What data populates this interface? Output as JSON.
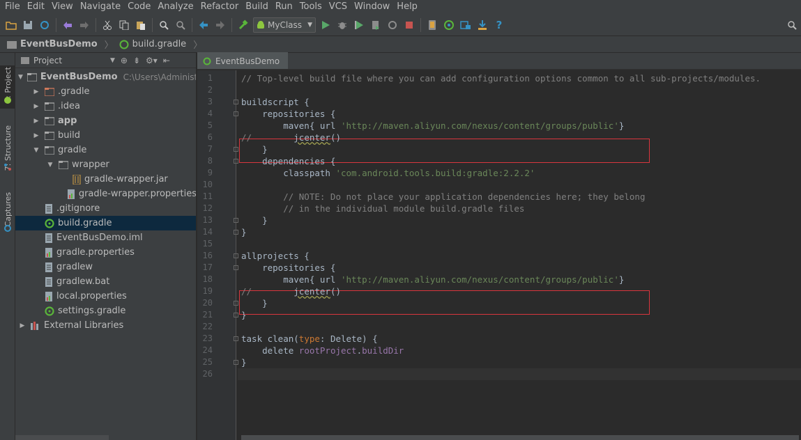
{
  "menu": [
    "File",
    "Edit",
    "View",
    "Navigate",
    "Code",
    "Analyze",
    "Refactor",
    "Build",
    "Run",
    "Tools",
    "VCS",
    "Window",
    "Help"
  ],
  "toolbar": {
    "run_config": "MyClass"
  },
  "breadcrumb": [
    "EventBusDemo",
    "build.gradle"
  ],
  "side_tabs": [
    "1: Project",
    "7: Structure",
    "Captures"
  ],
  "project": {
    "header": "Project",
    "tree": [
      {
        "label": "EventBusDemo",
        "path": "C:\\Users\\Administra",
        "indent": 0,
        "arrow": "down",
        "icon": "folder",
        "bold": true
      },
      {
        "label": ".gradle",
        "indent": 1,
        "arrow": "right",
        "icon": "folder-red"
      },
      {
        "label": ".idea",
        "indent": 1,
        "arrow": "right",
        "icon": "folder"
      },
      {
        "label": "app",
        "indent": 1,
        "arrow": "right",
        "icon": "folder",
        "bold": true
      },
      {
        "label": "build",
        "indent": 1,
        "arrow": "right",
        "icon": "folder"
      },
      {
        "label": "gradle",
        "indent": 1,
        "arrow": "down",
        "icon": "folder"
      },
      {
        "label": "wrapper",
        "indent": 2,
        "arrow": "down",
        "icon": "folder"
      },
      {
        "label": "gradle-wrapper.jar",
        "indent": 3,
        "arrow": "",
        "icon": "jar"
      },
      {
        "label": "gradle-wrapper.properties",
        "indent": 3,
        "arrow": "",
        "icon": "props"
      },
      {
        "label": ".gitignore",
        "indent": 1,
        "arrow": "",
        "icon": "file"
      },
      {
        "label": "build.gradle",
        "indent": 1,
        "arrow": "",
        "icon": "gradle",
        "selected": true
      },
      {
        "label": "EventBusDemo.iml",
        "indent": 1,
        "arrow": "",
        "icon": "file"
      },
      {
        "label": "gradle.properties",
        "indent": 1,
        "arrow": "",
        "icon": "props"
      },
      {
        "label": "gradlew",
        "indent": 1,
        "arrow": "",
        "icon": "file"
      },
      {
        "label": "gradlew.bat",
        "indent": 1,
        "arrow": "",
        "icon": "file"
      },
      {
        "label": "local.properties",
        "indent": 1,
        "arrow": "",
        "icon": "props"
      },
      {
        "label": "settings.gradle",
        "indent": 1,
        "arrow": "",
        "icon": "gradle"
      },
      {
        "label": "External Libraries",
        "indent": 0,
        "arrow": "right",
        "icon": "libs"
      }
    ]
  },
  "editor": {
    "tab": "EventBusDemo",
    "lines": [
      [
        {
          "t": "// Top-level build file where you can add configuration options common to all sub-projects/modules.",
          "c": "cm"
        }
      ],
      [],
      [
        {
          "t": "buildscript {"
        }
      ],
      [
        {
          "t": "    repositories {"
        }
      ],
      [
        {
          "t": "        maven{ url "
        },
        {
          "t": "'http://maven.aliyun.com/nexus/content/groups/public'",
          "c": "str"
        },
        {
          "t": "}"
        }
      ],
      [
        {
          "t": "//        ",
          "c": "cm"
        },
        {
          "t": "jcenter",
          "c": "warn"
        },
        {
          "t": "()"
        }
      ],
      [
        {
          "t": "    }"
        }
      ],
      [
        {
          "t": "    dependencies {"
        }
      ],
      [
        {
          "t": "        classpath "
        },
        {
          "t": "'com.android.tools.build:gradle:2.2.2'",
          "c": "str"
        }
      ],
      [],
      [
        {
          "t": "        // NOTE: Do not place your application dependencies here; they belong",
          "c": "cm"
        }
      ],
      [
        {
          "t": "        // in the individual module build.gradle files",
          "c": "cm"
        }
      ],
      [
        {
          "t": "    }"
        }
      ],
      [
        {
          "t": "}"
        }
      ],
      [],
      [
        {
          "t": "allprojects {"
        }
      ],
      [
        {
          "t": "    repositories {"
        }
      ],
      [
        {
          "t": "        maven{ url "
        },
        {
          "t": "'http://maven.aliyun.com/nexus/content/groups/public'",
          "c": "str"
        },
        {
          "t": "}"
        }
      ],
      [
        {
          "t": "//        ",
          "c": "cm"
        },
        {
          "t": "jcenter",
          "c": "warn"
        },
        {
          "t": "()"
        }
      ],
      [
        {
          "t": "    }"
        }
      ],
      [
        {
          "t": "}"
        }
      ],
      [],
      [
        {
          "t": "task clean("
        },
        {
          "t": "type",
          "c": "kw"
        },
        {
          "t": ": Delete) {"
        }
      ],
      [
        {
          "t": "    delete "
        },
        {
          "t": "rootProject",
          "c": "prop"
        },
        {
          "t": "."
        },
        {
          "t": "buildDir",
          "c": "prop"
        }
      ],
      [
        {
          "t": "}"
        }
      ],
      []
    ]
  }
}
